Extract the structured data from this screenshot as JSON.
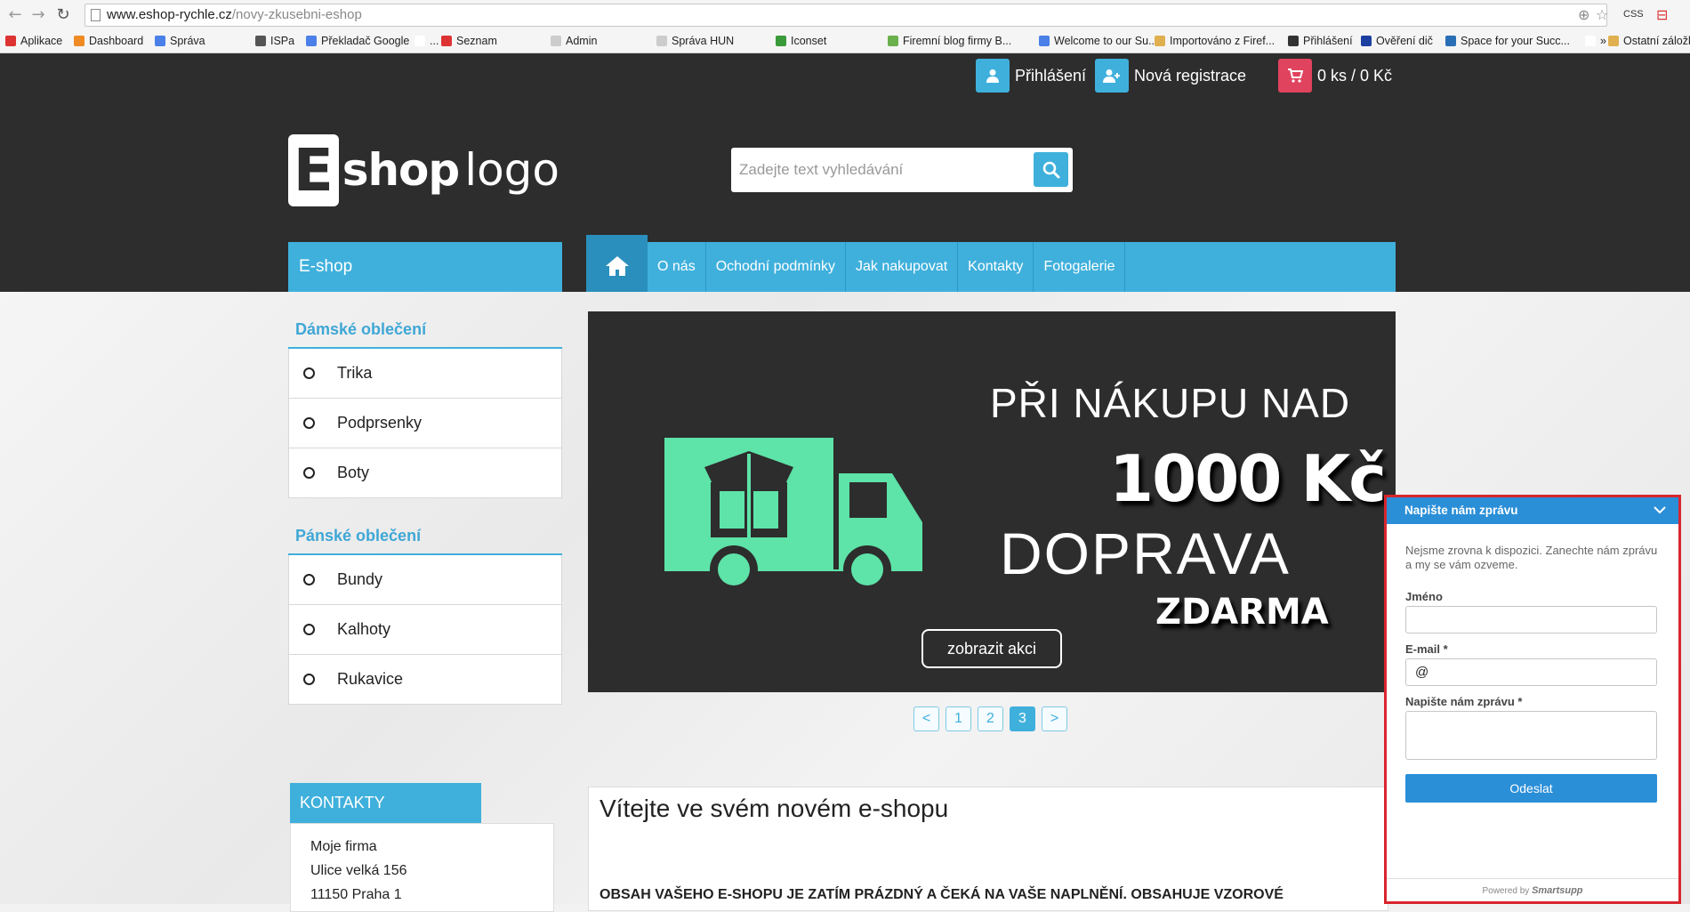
{
  "browser": {
    "url_host": "www.eshop-rychle.cz",
    "url_path": "/novy-zkusebni-eshop",
    "ext_label": "CSS",
    "bookmarks": [
      {
        "label": "Aplikace",
        "color": "#d33"
      },
      {
        "label": "Dashboard",
        "color": "#f08a24"
      },
      {
        "label": "Správa",
        "color": "#4a80e8"
      },
      {
        "label": "ISPa",
        "color": "#555"
      },
      {
        "label": "Překladač Google",
        "color": "#4a80e8"
      },
      {
        "label": "...",
        "color": "#ffffff"
      },
      {
        "label": "Seznam",
        "color": "#d33"
      },
      {
        "label": "Admin",
        "color": "#cccccc"
      },
      {
        "label": "Správa  HUN",
        "color": "#cccccc"
      },
      {
        "label": "Iconset",
        "color": "#3a9a3a"
      },
      {
        "label": "Firemní blog firmy B...",
        "color": "#6ab04c"
      },
      {
        "label": "Welcome to our Su...",
        "color": "#4a80e8"
      },
      {
        "label": "Importováno z Firef...",
        "color": "#e0b050"
      },
      {
        "label": "Přihlášení",
        "color": "#333"
      },
      {
        "label": "Ověření dič",
        "color": "#1c3fa0"
      },
      {
        "label": "Space for your Succ...",
        "color": "#2a6fb5"
      },
      {
        "label": "»",
        "color": "#ffffff"
      },
      {
        "label": "Ostatní záložky",
        "color": "#e0b050"
      }
    ]
  },
  "header": {
    "login_label": "Přihlášení",
    "register_label": "Nová registrace",
    "cart_label": "0 ks / 0 Kč",
    "logo_letter": "E",
    "logo_shop": "shop",
    "logo_logo": "logo",
    "search_placeholder": "Zadejte text vyhledávání",
    "accent": "#3fb0dc",
    "cart_color": "#e0435e"
  },
  "nav": {
    "category_title": "E-shop",
    "items": [
      "O nás",
      "Ochodní podmínky",
      "Jak nakupovat",
      "Kontakty",
      "Fotogalerie"
    ]
  },
  "sidebar": {
    "women_title": "Dámské oblečení",
    "women_items": [
      "Trika",
      "Podprsenky",
      "Boty"
    ],
    "men_title": "Pánské oblečení",
    "men_items": [
      "Bundy",
      "Kalhoty",
      "Rukavice"
    ]
  },
  "banner": {
    "line1": "PŘI NÁKUPU NAD",
    "line2": "1000 Kč",
    "line3": "DOPRAVA",
    "line4": "ZDARMA",
    "button_label": "zobrazit akci",
    "truck_color": "#5ee3a8"
  },
  "pager": {
    "prev": "<",
    "pages": [
      "1",
      "2",
      "3"
    ],
    "active_page": "3",
    "next": ">"
  },
  "contacts": {
    "title": "KONTAKTY",
    "lines": [
      "Moje firma",
      "Ulice velká 156",
      "11150 Praha 1"
    ]
  },
  "welcome": {
    "title": "Vítejte ve svém novém e-shopu",
    "text": "OBSAH VAŠEHO E-SHOPU JE ZATÍM PRÁZDNÝ A ČEKÁ NA VAŠE NAPLNĚNÍ. OBSAHUJE VZOROVÉ"
  },
  "chat": {
    "title": "Napište nám zprávu",
    "info": "Nejsme zrovna k dispozici. Zanechte nám zprávu a my se vám ozveme.",
    "name_label": "Jméno",
    "email_label": "E-mail *",
    "email_value": "@",
    "message_label": "Napište nám zprávu *",
    "send_label": "Odeslat",
    "powered_by": "Powered by",
    "brand": "Smartsupp",
    "color": "#2b8fd8"
  }
}
